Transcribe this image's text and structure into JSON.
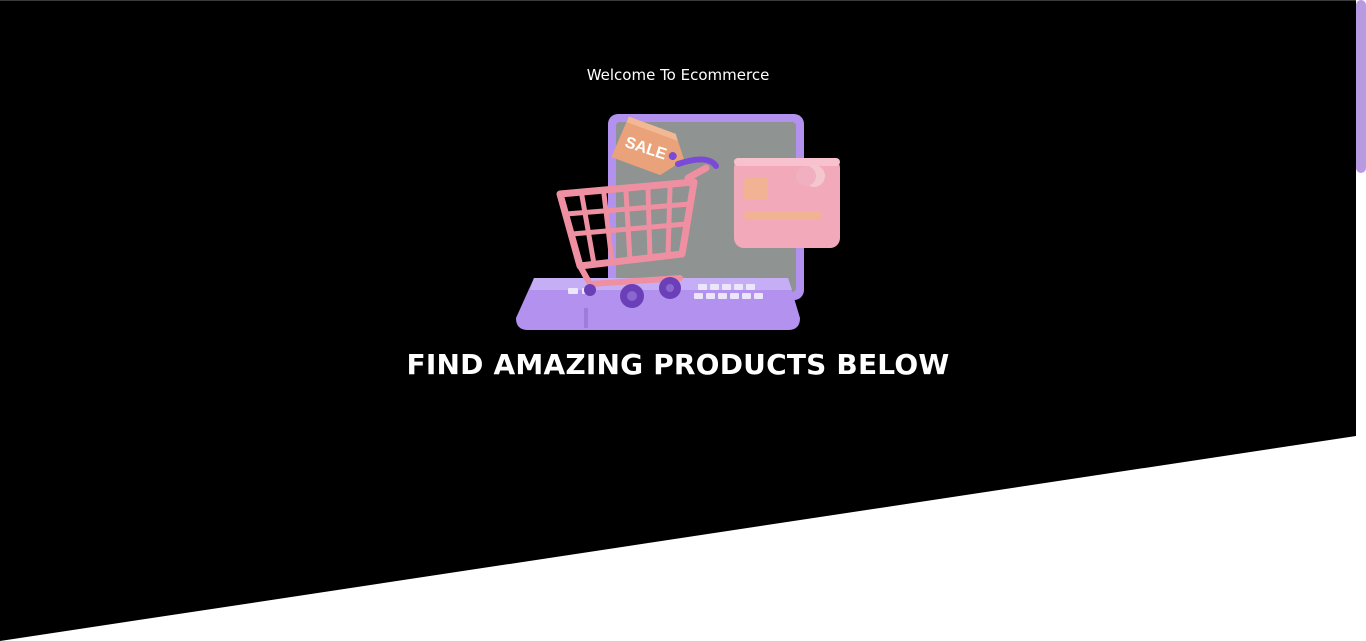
{
  "hero": {
    "welcome_text": "Welcome To Ecommerce",
    "headline": "FIND AMAZING PRODUCTS BELOW",
    "illustration": {
      "icon": "shopping-cart-laptop-sale-illustration",
      "tag_text": "SALE"
    }
  },
  "colors": {
    "hero_background": "#000000",
    "page_background": "#ffffff",
    "text": "#ffffff",
    "scrollbar_thumb": "#b79ae0"
  }
}
